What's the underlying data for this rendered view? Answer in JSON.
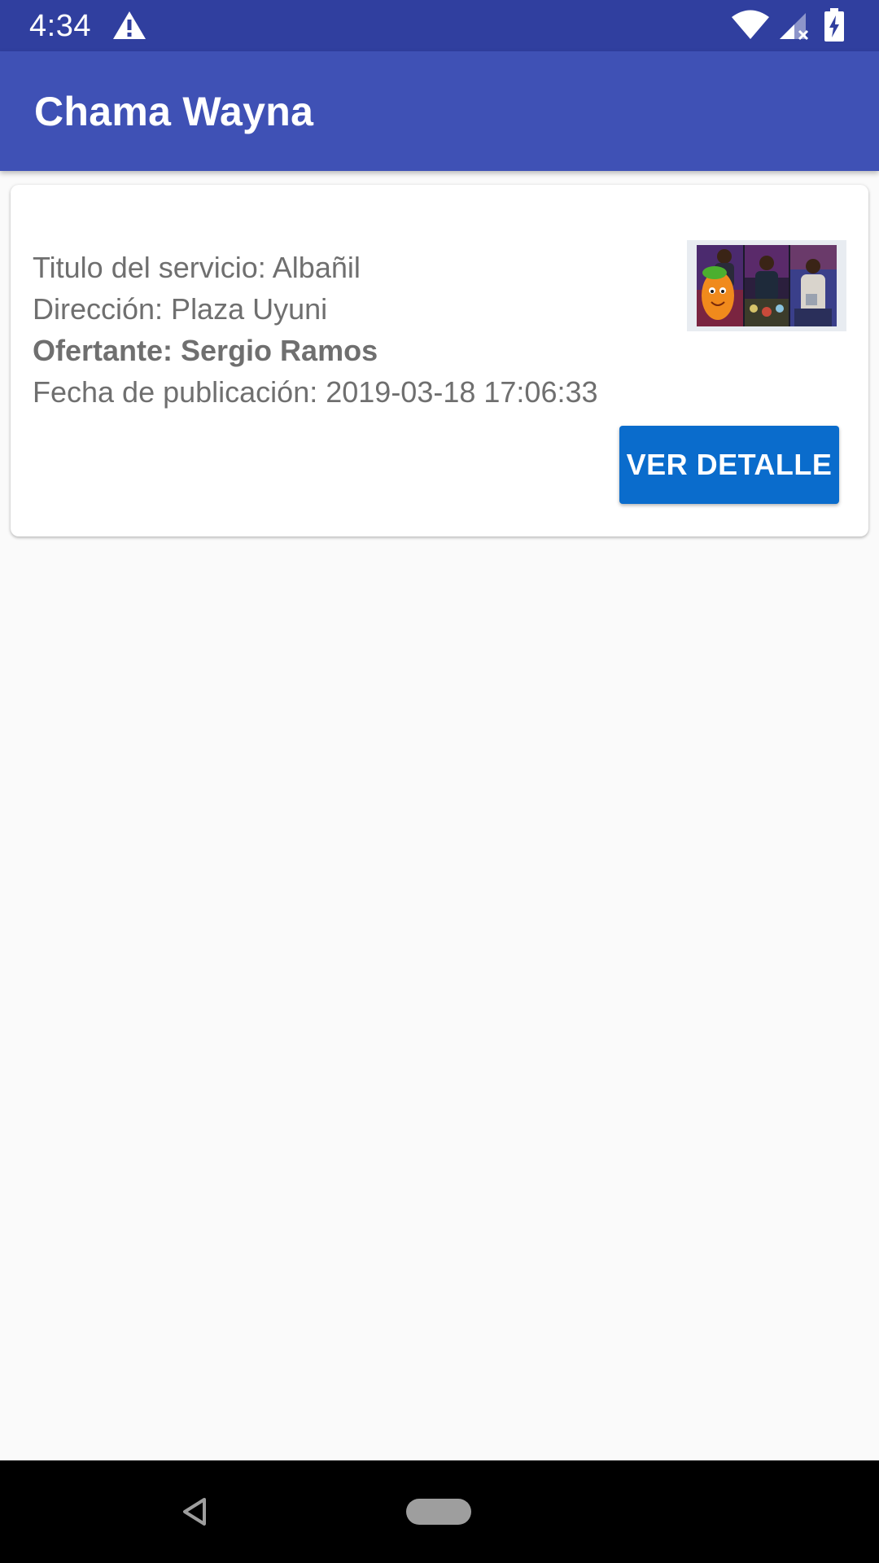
{
  "status_bar": {
    "time": "4:34",
    "icons": [
      "warning-icon",
      "wifi-icon",
      "signal-icon",
      "battery-charging-icon"
    ]
  },
  "app_bar": {
    "title": "Chama Wayna"
  },
  "card": {
    "title_line": "Titulo del servicio: Albañil",
    "address_line": "Dirección: Plaza Uyuni",
    "provider_line": "Ofertante: Sergio Ramos",
    "date_line": "Fecha de publicación: 2019-03-18 17:06:33",
    "button_label": "VER DETALLE"
  },
  "nav_bar": {
    "icons": [
      "back-icon",
      "home-icon"
    ]
  },
  "colors": {
    "status_bar": "#303f9f",
    "app_bar": "#3f51b5",
    "button": "#0a6ccc",
    "text_secondary": "#6f6f6f",
    "background": "#fafafa"
  }
}
